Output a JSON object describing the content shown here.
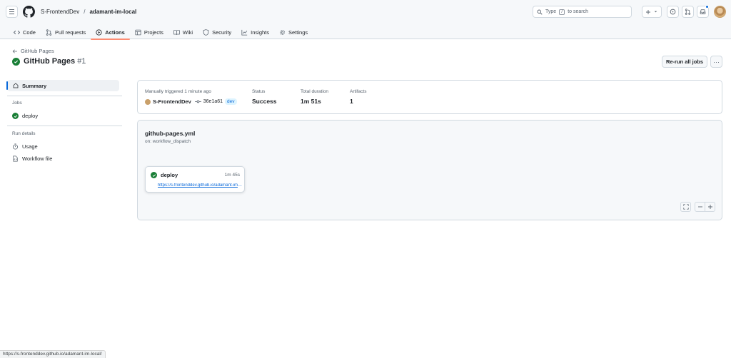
{
  "header": {
    "owner": "S-FrontendDev",
    "separator": "/",
    "repo": "adamant-im-local",
    "search": {
      "prefix": "Type",
      "key": "/",
      "suffix": "to search"
    },
    "icons": [
      "menu-icon",
      "github-logo-icon",
      "search-icon",
      "plus-icon",
      "chevron-down-icon",
      "issue-icon",
      "pull-request-icon",
      "inbox-icon",
      "avatar"
    ]
  },
  "tabs": [
    {
      "label": "Code",
      "icon": "code-icon"
    },
    {
      "label": "Pull requests",
      "icon": "pull-request-icon"
    },
    {
      "label": "Actions",
      "icon": "play-icon",
      "selected": true
    },
    {
      "label": "Projects",
      "icon": "table-icon"
    },
    {
      "label": "Wiki",
      "icon": "book-icon"
    },
    {
      "label": "Security",
      "icon": "shield-icon"
    },
    {
      "label": "Insights",
      "icon": "graph-icon"
    },
    {
      "label": "Settings",
      "icon": "gear-icon"
    }
  ],
  "run": {
    "back_label": "GitHub Pages",
    "title": "GitHub Pages",
    "number": "#1",
    "rerun_label": "Re-run all jobs",
    "more_label": "···"
  },
  "sidebar": {
    "summary": "Summary",
    "jobs_heading": "Jobs",
    "job": "deploy",
    "details_heading": "Run details",
    "usage": "Usage",
    "workflow_file": "Workflow file"
  },
  "summary": {
    "trigger_label": "Manually triggered 1 minute ago",
    "user": "S-FrontendDev",
    "commit": "36e1a61",
    "branch": "dev",
    "status_label": "Status",
    "status_value": "Success",
    "duration_label": "Total duration",
    "duration_value": "1m 51s",
    "artifacts_label": "Artifacts",
    "artifacts_value": "1"
  },
  "graph": {
    "file": "github-pages.yml",
    "on": "on: workflow_dispatch",
    "job_name": "deploy",
    "job_time": "1m 45s",
    "job_link": "https://s-frontenddev.github.io/adamant-im-local/"
  },
  "statusbar": {
    "url": "https://s-frontenddev.github.io/adamant-im-local/"
  },
  "colors": {
    "success": "#1a7f37",
    "accent": "#0969da",
    "tab_underline": "#fd8c73"
  }
}
